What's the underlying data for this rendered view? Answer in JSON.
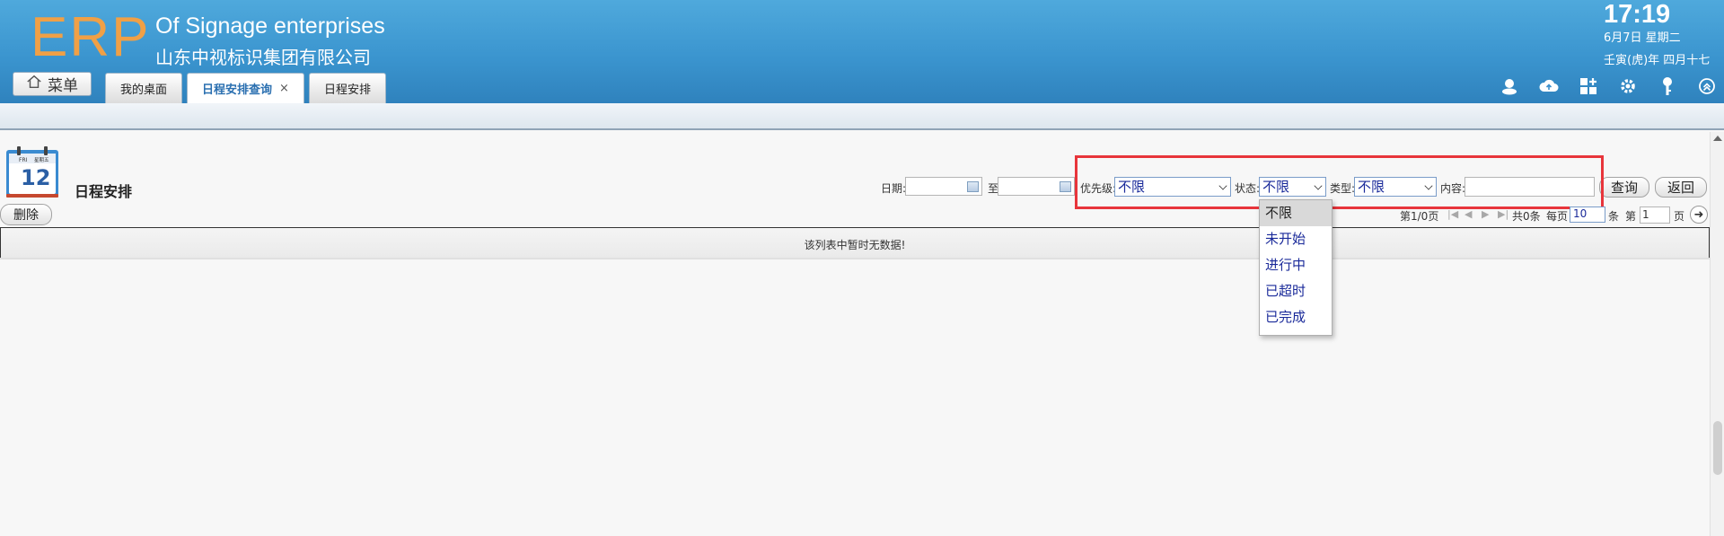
{
  "header": {
    "logo": "ERP",
    "company_en": "Of Signage enterprises",
    "company_cn": "山东中视标识集团有限公司",
    "time": "17:19",
    "date": "6月7日 星期二",
    "lunar": "壬寅(虎)年 四月十七",
    "menu_label": "菜单",
    "tabs": [
      {
        "label": "我的桌面"
      },
      {
        "label": "日程安排查询",
        "close": "×"
      },
      {
        "label": "日程安排"
      }
    ],
    "tool_icons": [
      "user-icon",
      "cloud-upload-icon",
      "grid-add-icon",
      "gear-icon",
      "key-icon",
      "collapse-icon"
    ]
  },
  "page": {
    "title": "日程安排",
    "calendar_icon": {
      "day": "FRI",
      "label": "星期五",
      "date": "12"
    }
  },
  "filters": {
    "date_label": "日期:",
    "to_label": "至",
    "priority_label": "优先级:",
    "priority_value": "不限",
    "status_label": "状态:",
    "status_value": "不限",
    "type_label": "类型:",
    "type_value": "不限",
    "content_label": "内容:",
    "content_value": "",
    "query_button": "查询",
    "back_button": "返回"
  },
  "status_options": [
    "不限",
    "未开始",
    "进行中",
    "已超时",
    "已完成"
  ],
  "toolbar": {
    "delete_button": "删除"
  },
  "pager": {
    "page_info": "第1/0页",
    "total": "共0条",
    "per_page_label": "每页",
    "per_page_value": "10",
    "unit_label": "条",
    "page_label": "第",
    "page_value": "1",
    "page_suffix": "页"
  },
  "grid": {
    "empty_message": "该列表中暂时无数据!"
  }
}
